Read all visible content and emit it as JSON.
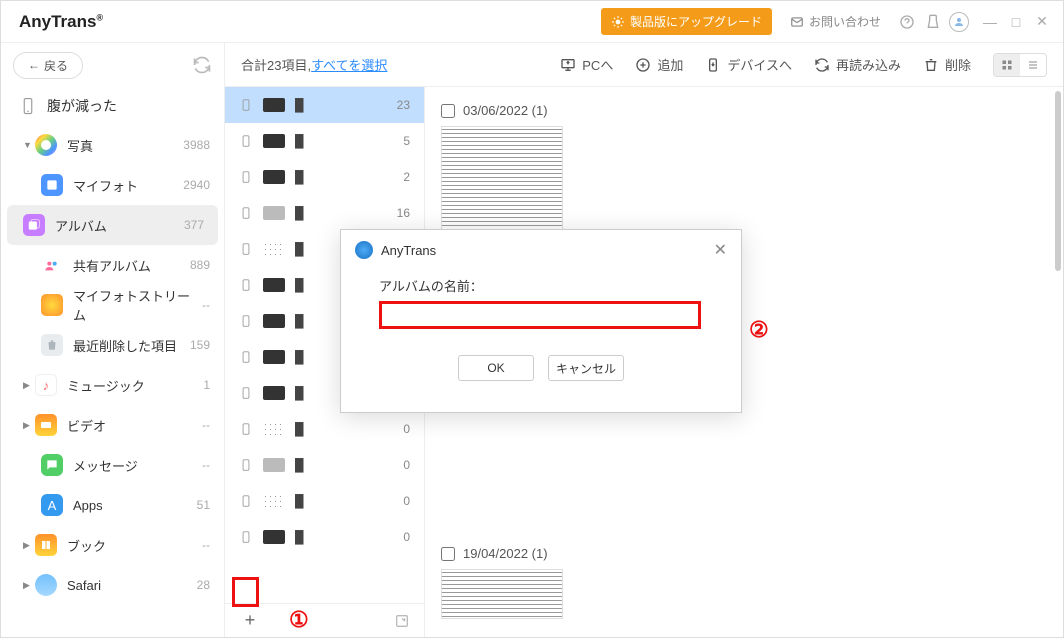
{
  "brand": "AnyTrans",
  "upgrade_label": "製品版にアップグレード",
  "contact_label": "お問い合わせ",
  "back_label": "戻る",
  "device_name": "腹が減った",
  "nav": {
    "photos": {
      "label": "写真",
      "count": "3988"
    },
    "myphoto": {
      "label": "マイフォト",
      "count": "2940"
    },
    "album": {
      "label": "アルバム",
      "count": "377"
    },
    "shared": {
      "label": "共有アルバム",
      "count": "889"
    },
    "stream": {
      "label": "マイフォトストリーム",
      "count": "--"
    },
    "trash": {
      "label": "最近削除した項目",
      "count": "159"
    },
    "music": {
      "label": "ミュージック",
      "count": "1"
    },
    "video": {
      "label": "ビデオ",
      "count": "--"
    },
    "msg": {
      "label": "メッセージ",
      "count": "--"
    },
    "apps": {
      "label": "Apps",
      "count": "51"
    },
    "book": {
      "label": "ブック",
      "count": "--"
    },
    "safari": {
      "label": "Safari",
      "count": "28"
    }
  },
  "toolbar": {
    "summary_prefix": "合計23項目,",
    "select_all": "すべてを選択",
    "to_pc": "PCへ",
    "add": "追加",
    "to_device": "デバイスへ",
    "reload": "再読み込み",
    "delete": "削除"
  },
  "albums": [
    {
      "count": "23",
      "sel": true,
      "thumb": "dark"
    },
    {
      "count": "5",
      "thumb": "dark"
    },
    {
      "count": "2",
      "thumb": "dark"
    },
    {
      "count": "16",
      "thumb": "grey"
    },
    {
      "count": "",
      "thumb": "dots"
    },
    {
      "count": "",
      "thumb": "dark"
    },
    {
      "count": "",
      "thumb": "dark"
    },
    {
      "count": "",
      "thumb": "dark"
    },
    {
      "count": "",
      "thumb": "dark"
    },
    {
      "count": "0",
      "thumb": "dots"
    },
    {
      "count": "0",
      "thumb": "grey"
    },
    {
      "count": "0",
      "thumb": "dots"
    },
    {
      "count": "0",
      "thumb": "dark"
    }
  ],
  "dates": {
    "g1": "03/06/2022 (1)",
    "g2": "19/04/2022 (1)"
  },
  "modal": {
    "title": "AnyTrans",
    "label": "アルバムの名前：",
    "ok": "OK",
    "cancel": "キャンセル"
  },
  "callouts": {
    "one": "①",
    "two": "②"
  }
}
